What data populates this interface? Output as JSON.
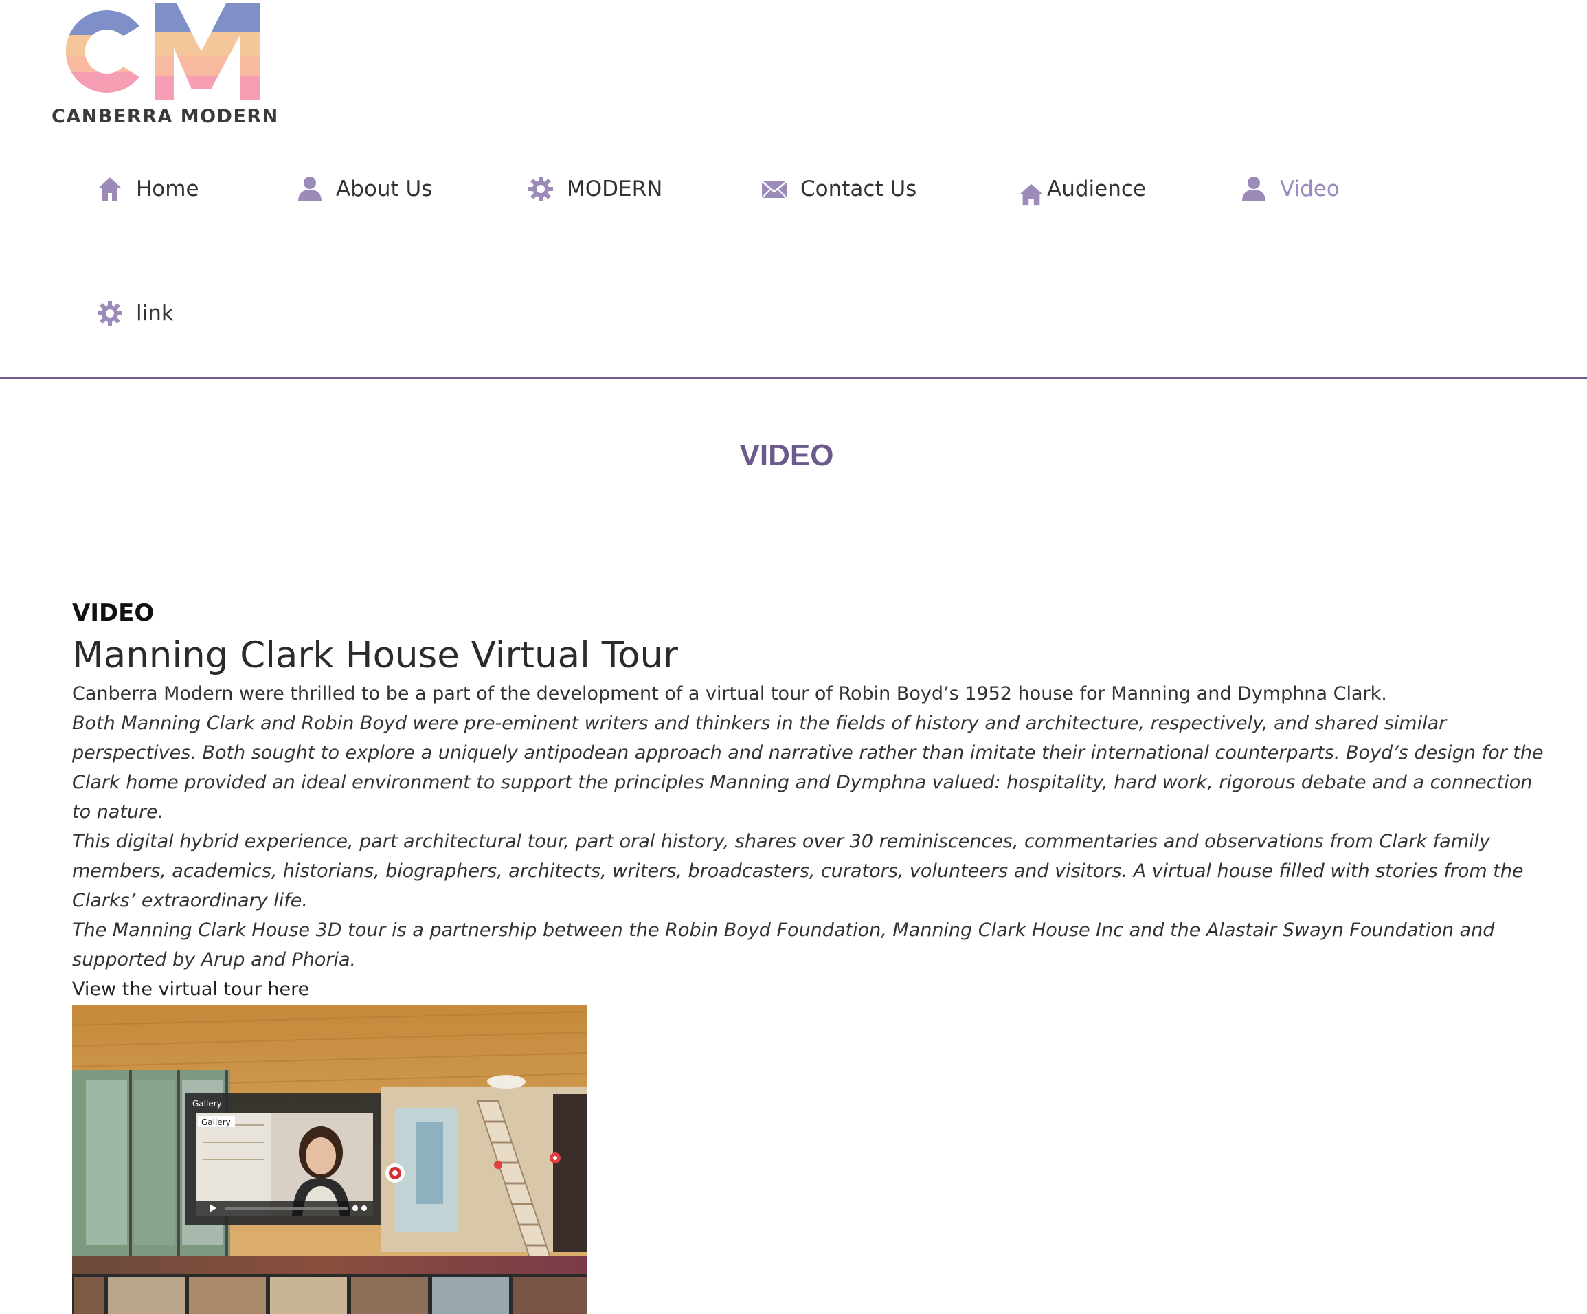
{
  "logo": {
    "letters": "CM",
    "text": "CANBERRA MODERN"
  },
  "nav": {
    "items": [
      {
        "label": "Home",
        "icon": "home-icon"
      },
      {
        "label": "About Us",
        "icon": "user-icon"
      },
      {
        "label": "MODERN",
        "icon": "gear-icon"
      },
      {
        "label": "Contact Us",
        "icon": "envelope-icon"
      },
      {
        "label": "Audience",
        "icon": "house-icon"
      },
      {
        "label": "Video",
        "icon": "user-icon",
        "active": true
      },
      {
        "label": "link",
        "icon": "gear-icon"
      }
    ]
  },
  "page": {
    "title": "VIDEO"
  },
  "article": {
    "section_label": "VIDEO",
    "title": "Manning Clark House Virtual Tour",
    "intro": "Canberra Modern were thrilled to be a part of the development of a virtual tour of Robin Boyd’s 1952 house for Manning and Dymphna Clark.",
    "p1": "Both Manning Clark and Robin Boyd were pre-eminent writers and thinkers in the fields of history and architecture, respectively, and shared similar perspectives. Both sought to explore a uniquely antipodean approach and narrative rather than imitate their international counterparts. Boyd’s design for the Clark home provided an ideal environment to support the principles Manning and Dymphna valued: hospitality, hard work, rigorous debate and a connection to nature.",
    "p2": "This digital hybrid experience, part architectural tour, part oral history, shares over 30 reminiscences, commentaries and observations from Clark family members, academics, historians, biographers, architects, writers, broadcasters, curators, volunteers and visitors. A virtual house filled with stories from the Clarks’ extraordinary life.",
    "p3": "The Manning Clark House 3D tour is a partnership between the Robin Boyd Foundation, Manning Clark House Inc and the Alastair Swayn Foundation and supported by Arup and Phoria.",
    "link": "View the virtual tour here"
  },
  "thumbnail": {
    "popup_title": "Gallery",
    "popup_tab": "Gallery"
  },
  "colors": {
    "accent": "#6c5a8c",
    "nav_active": "#9a8ac0",
    "nav_icon": "#9c8bb8",
    "divider": "#6e5a8c"
  }
}
